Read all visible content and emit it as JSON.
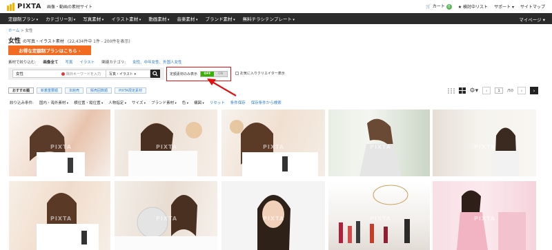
{
  "header": {
    "logo": "PIXTA",
    "tagline": "画像・動画の素材サイト",
    "links": [
      "カート",
      "検討中リスト",
      "サポート ▾",
      "サイトマップ"
    ],
    "cart_count": "0"
  },
  "nav": {
    "items": [
      "定額制プラン",
      "カテゴリー別",
      "写真素材",
      "イラスト素材",
      "動画素材",
      "音楽素材",
      "ブランド素材",
      "無料チラシテンプレート"
    ],
    "mypage": "マイページ ▾"
  },
  "breadcrumb": {
    "home": "ホーム",
    "sep": " > ",
    "current": "女性"
  },
  "page": {
    "title": "女性",
    "title_suffix": "の写真・イラスト素材",
    "count": "(22,434件中 1件 - 200件を表示)",
    "promo": "お得な定額制プランはこちら ›"
  },
  "filter_line": {
    "label": "素材で絞り込む:",
    "all": "画像全て",
    "photo": "写真",
    "illust": "イラスト",
    "related_label": "関連カテゴリ:",
    "related": "女性、中年女性、外国人女性"
  },
  "search": {
    "keyword": "女性",
    "exclude_placeholder": "除外キーワードを入力",
    "type": "写真・イラスト ▾"
  },
  "toggle": {
    "label": "定額素材のみ表示",
    "on": "OFF",
    "off": "ON"
  },
  "fav_label": "お気に入りクリエイター表示",
  "tabs": [
    "おすすめ順",
    "新着重要順",
    "本館売",
    "販売回数順",
    "PIXTA限定素材"
  ],
  "pagination": {
    "current": "1",
    "total": "/50"
  },
  "filters": [
    "絞り込み条件:",
    "国内・海外素材",
    "横位置・縦位置",
    "人物指定",
    "サイズ",
    "ブランド素材",
    "色",
    "構図"
  ],
  "filter_links": [
    "リセット",
    "条件保存",
    "保存条件から検索"
  ],
  "watermark": "PIXTA",
  "colors": {
    "nav_bg": "#2b2b2b",
    "promo": "#f26b21",
    "toggle_on": "#36b300",
    "highlight": "#e01010",
    "link": "#2a7bd4"
  }
}
